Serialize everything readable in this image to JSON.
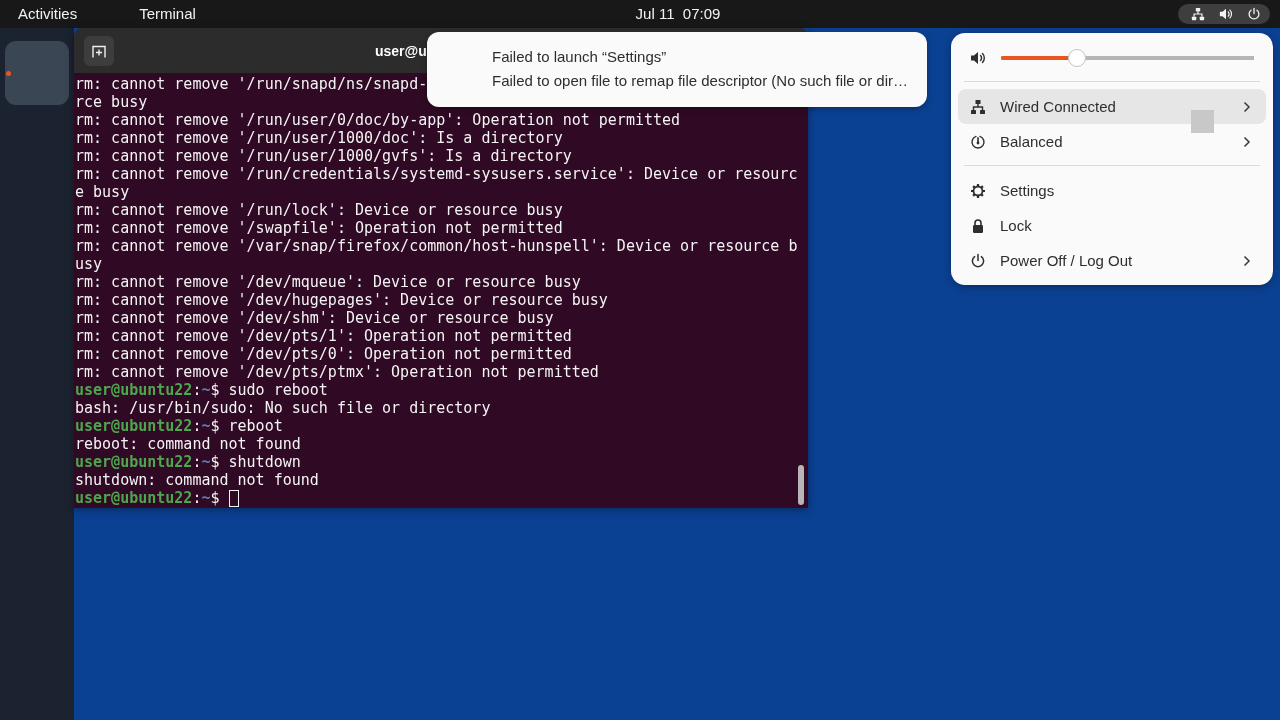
{
  "top_bar": {
    "activities": "Activities",
    "app_menu": "Terminal",
    "clock": "Jul 11  07:09",
    "tray": {
      "active": true
    }
  },
  "dock": {
    "apps": [
      {
        "running": true
      }
    ]
  },
  "terminal": {
    "title": "user@u",
    "lines": [
      {
        "kind": "output",
        "text": "rm: cannot remove '/run/snapd/ns/snapd-"
      },
      {
        "kind": "output",
        "text": "rce busy"
      },
      {
        "kind": "output",
        "text": "rm: cannot remove '/run/user/0/doc/by-app': Operation not permitted"
      },
      {
        "kind": "output",
        "text": "rm: cannot remove '/run/user/1000/doc': Is a directory"
      },
      {
        "kind": "output",
        "text": "rm: cannot remove '/run/user/1000/gvfs': Is a directory"
      },
      {
        "kind": "output",
        "text": "rm: cannot remove '/run/credentials/systemd-sysusers.service': Device or resourc"
      },
      {
        "kind": "output",
        "text": "e busy"
      },
      {
        "kind": "output",
        "text": "rm: cannot remove '/run/lock': Device or resource busy"
      },
      {
        "kind": "output",
        "text": "rm: cannot remove '/swapfile': Operation not permitted"
      },
      {
        "kind": "output",
        "text": "rm: cannot remove '/var/snap/firefox/common/host-hunspell': Device or resource b"
      },
      {
        "kind": "output",
        "text": "usy"
      },
      {
        "kind": "output",
        "text": "rm: cannot remove '/dev/mqueue': Device or resource busy"
      },
      {
        "kind": "output",
        "text": "rm: cannot remove '/dev/hugepages': Device or resource busy"
      },
      {
        "kind": "output",
        "text": "rm: cannot remove '/dev/shm': Device or resource busy"
      },
      {
        "kind": "output",
        "text": "rm: cannot remove '/dev/pts/1': Operation not permitted"
      },
      {
        "kind": "output",
        "text": "rm: cannot remove '/dev/pts/0': Operation not permitted"
      },
      {
        "kind": "output",
        "text": "rm: cannot remove '/dev/pts/ptmx': Operation not permitted"
      },
      {
        "kind": "prompt",
        "user": "user@ubuntu22",
        "sep": ":",
        "dir": "~",
        "sign": "$",
        "command": "sudo reboot",
        "cursor": false
      },
      {
        "kind": "output",
        "text": "bash: /usr/bin/sudo: No such file or directory"
      },
      {
        "kind": "prompt",
        "user": "user@ubuntu22",
        "sep": ":",
        "dir": "~",
        "sign": "$",
        "command": "reboot",
        "cursor": false
      },
      {
        "kind": "output",
        "text": "reboot: command not found"
      },
      {
        "kind": "prompt",
        "user": "user@ubuntu22",
        "sep": ":",
        "dir": "~",
        "sign": "$",
        "command": "shutdown",
        "cursor": false
      },
      {
        "kind": "output",
        "text": "shutdown: command not found"
      },
      {
        "kind": "prompt",
        "user": "user@ubuntu22",
        "sep": ":",
        "dir": "~",
        "sign": "$",
        "cursor": true
      }
    ]
  },
  "notification": {
    "title": "Failed to launch “Settings”",
    "body": "Failed to open file to remap file descriptor (No such file or dir…"
  },
  "quick_settings": {
    "volume": {
      "level": 0.3
    },
    "groups": [
      [
        {
          "label": "Wired Connected",
          "highlighted": true,
          "submenu": true
        },
        {
          "label": "Balanced",
          "highlighted": false,
          "submenu": true
        }
      ],
      [
        {
          "label": "Settings",
          "highlighted": false,
          "submenu": false
        },
        {
          "label": "Lock",
          "highlighted": false,
          "submenu": false
        },
        {
          "label": "Power Off / Log Out",
          "highlighted": false,
          "submenu": true
        }
      ]
    ]
  }
}
